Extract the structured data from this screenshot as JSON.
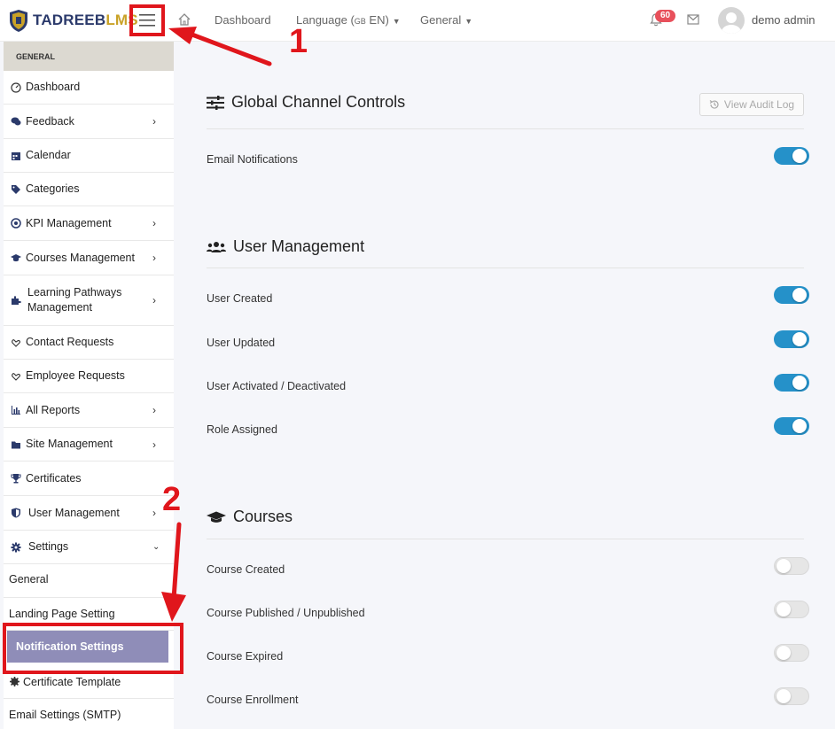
{
  "header": {
    "logo_part1": "TADREEB",
    "logo_part2": "LMS",
    "nav_dashboard": "Dashboard",
    "nav_language": "Language (",
    "nav_language_flag": "GB",
    "nav_language_code": " EN)",
    "nav_general": "General",
    "notification_count": "60",
    "user_name": "demo admin"
  },
  "sidebar": {
    "section_header": "GENERAL",
    "items": [
      {
        "label": "Dashboard",
        "icon": "dashboard-gauge-icon",
        "has_chevron": false
      },
      {
        "label": "Feedback",
        "icon": "comments-icon",
        "has_chevron": true
      },
      {
        "label": "Calendar",
        "icon": "calendar-icon",
        "has_chevron": false
      },
      {
        "label": "Categories",
        "icon": "tags-icon",
        "has_chevron": false
      },
      {
        "label": "KPI Management",
        "icon": "target-icon",
        "has_chevron": true
      },
      {
        "label": "Courses Management",
        "icon": "graduation-cap-icon",
        "has_chevron": true
      },
      {
        "label": "Learning Pathways Management",
        "icon": "puzzle-icon",
        "has_chevron": true
      },
      {
        "label": "Contact Requests",
        "icon": "hand-heart-icon",
        "has_chevron": false
      },
      {
        "label": "Employee Requests",
        "icon": "hand-heart-icon",
        "has_chevron": false
      },
      {
        "label": "All Reports",
        "icon": "bar-chart-icon",
        "has_chevron": true
      },
      {
        "label": "Site Management",
        "icon": "folder-icon",
        "has_chevron": true
      },
      {
        "label": "Certificates",
        "icon": "trophy-icon",
        "has_chevron": false
      },
      {
        "label": "User Management",
        "icon": "shield-icon",
        "has_chevron": true
      },
      {
        "label": "Settings",
        "icon": "gear-icon",
        "has_chevron": true
      }
    ],
    "settings_sub": {
      "general": "General",
      "landing": "Landing Page Setting",
      "notification": "Notification Settings",
      "certificate_template": "Certificate Template",
      "email_settings": "Email Settings (SMTP)"
    }
  },
  "annotations": {
    "step1": "1",
    "step2": "2"
  },
  "main": {
    "global": {
      "title": "Global Channel Controls",
      "audit_button": "View Audit Log",
      "rows": [
        {
          "label": "Email Notifications",
          "on": true
        }
      ]
    },
    "user_mgmt": {
      "title": "User Management",
      "rows": [
        {
          "label": "User Created",
          "on": true
        },
        {
          "label": "User Updated",
          "on": true
        },
        {
          "label": "User Activated / Deactivated",
          "on": true
        },
        {
          "label": "Role Assigned",
          "on": true
        }
      ]
    },
    "courses": {
      "title": "Courses",
      "rows": [
        {
          "label": "Course Created",
          "on": false
        },
        {
          "label": "Course Published / Unpublished",
          "on": false
        },
        {
          "label": "Course Expired",
          "on": false
        },
        {
          "label": "Course Enrollment",
          "on": false
        }
      ]
    }
  },
  "colors": {
    "accent": "#2591c9",
    "active_nav": "#8f8db8",
    "annotation_red": "#e0161c",
    "badge": "#e8505b"
  }
}
